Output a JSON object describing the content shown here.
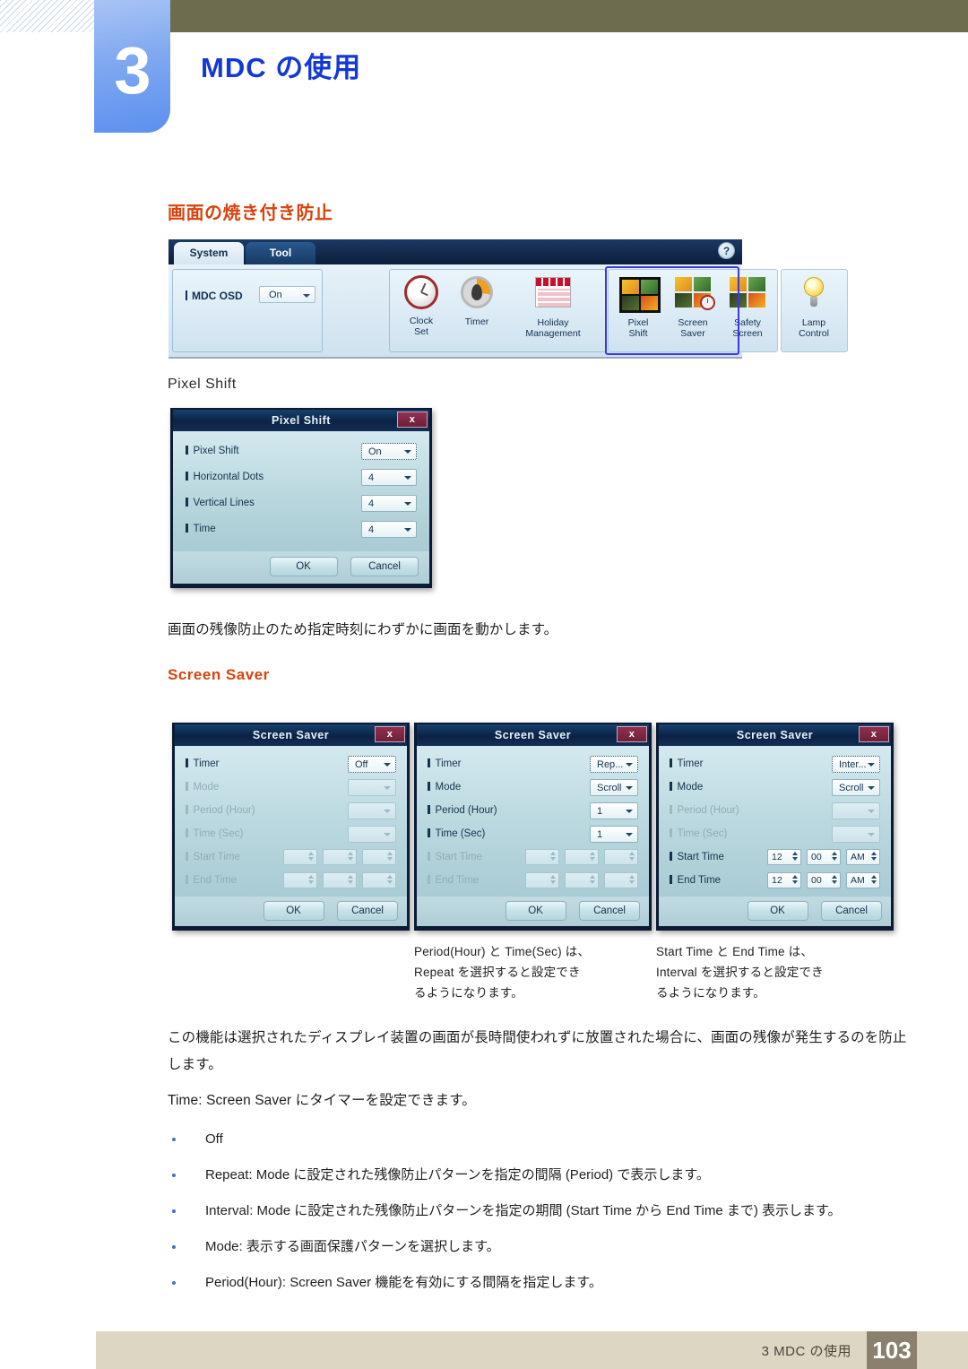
{
  "header": {
    "chapter_number": "3",
    "chapter_title": "MDC の使用"
  },
  "section": {
    "heading": "画面の焼き付き防止"
  },
  "toolbar": {
    "tabs": [
      {
        "label": "System",
        "active": true
      },
      {
        "label": "Tool",
        "active": false
      }
    ],
    "help_label": "?",
    "osd": {
      "label": "MDC OSD",
      "value": "On"
    },
    "items": [
      {
        "label_line1": "Clock",
        "label_line2": "Set",
        "icon": "clock-icon"
      },
      {
        "label_line1": "Timer",
        "label_line2": "",
        "icon": "timer-icon"
      },
      {
        "label_line1": "Holiday",
        "label_line2": "Management",
        "icon": "calendar-icon"
      },
      {
        "label_line1": "Pixel",
        "label_line2": "Shift",
        "icon": "pixel-shift-icon"
      },
      {
        "label_line1": "Screen",
        "label_line2": "Saver",
        "icon": "screen-saver-icon"
      },
      {
        "label_line1": "Safety",
        "label_line2": "Screen",
        "icon": "safety-screen-icon"
      },
      {
        "label_line1": "Lamp",
        "label_line2": "Control",
        "icon": "lamp-control-icon"
      }
    ]
  },
  "pixel_shift": {
    "subhead": "Pixel Shift",
    "dialog": {
      "title": "Pixel Shift",
      "close_label": "x",
      "rows": [
        {
          "label": "Pixel Shift",
          "value": "On",
          "disabled": false,
          "focus": true
        },
        {
          "label": "Horizontal Dots",
          "value": "4",
          "disabled": false,
          "focus": false
        },
        {
          "label": "Vertical Lines",
          "value": "4",
          "disabled": false,
          "focus": false
        },
        {
          "label": "Time",
          "value": "4",
          "disabled": false,
          "focus": false
        }
      ],
      "ok_label": "OK",
      "cancel_label": "Cancel"
    },
    "description": "画面の残像防止のため指定時刻にわずかに画面を動かします。"
  },
  "screen_saver": {
    "subhead": "Screen Saver",
    "dialogs": [
      {
        "title": "Screen Saver",
        "close_label": "x",
        "timer": {
          "label": "Timer",
          "value": "Off",
          "disabled": false,
          "focus": true
        },
        "mode": {
          "label": "Mode",
          "value": "",
          "disabled": true
        },
        "period": {
          "label": "Period (Hour)",
          "value": "",
          "disabled": true
        },
        "time": {
          "label": "Time (Sec)",
          "value": "",
          "disabled": true
        },
        "start_time": {
          "label": "Start Time",
          "hour": "",
          "minute": "",
          "meridiem": "",
          "disabled": true
        },
        "end_time": {
          "label": "End Time",
          "hour": "",
          "minute": "",
          "meridiem": "",
          "disabled": true
        },
        "ok_label": "OK",
        "cancel_label": "Cancel"
      },
      {
        "title": "Screen Saver",
        "close_label": "x",
        "timer": {
          "label": "Timer",
          "value": "Rep...",
          "disabled": false,
          "focus": true
        },
        "mode": {
          "label": "Mode",
          "value": "Scroll",
          "disabled": false
        },
        "period": {
          "label": "Period (Hour)",
          "value": "1",
          "disabled": false
        },
        "time": {
          "label": "Time (Sec)",
          "value": "1",
          "disabled": false
        },
        "start_time": {
          "label": "Start Time",
          "hour": "",
          "minute": "",
          "meridiem": "",
          "disabled": true
        },
        "end_time": {
          "label": "End Time",
          "hour": "",
          "minute": "",
          "meridiem": "",
          "disabled": true
        },
        "ok_label": "OK",
        "cancel_label": "Cancel"
      },
      {
        "title": "Screen Saver",
        "close_label": "x",
        "timer": {
          "label": "Timer",
          "value": "Inter...",
          "disabled": false,
          "focus": true
        },
        "mode": {
          "label": "Mode",
          "value": "Scroll",
          "disabled": false
        },
        "period": {
          "label": "Period (Hour)",
          "value": "",
          "disabled": true
        },
        "time": {
          "label": "Time (Sec)",
          "value": "",
          "disabled": true
        },
        "start_time": {
          "label": "Start Time",
          "hour": "12",
          "minute": "00",
          "meridiem": "AM",
          "disabled": false
        },
        "end_time": {
          "label": "End Time",
          "hour": "12",
          "minute": "00",
          "meridiem": "AM",
          "disabled": false
        },
        "ok_label": "OK",
        "cancel_label": "Cancel"
      }
    ],
    "captions": [
      "Period(Hour) と Time(Sec) は、\nRepeat を選択すると設定でき\nるようになります。",
      "Start Time と End Time は、\nInterval を選択すると設定でき\nるようになります。"
    ],
    "paragraph": "この機能は選択されたディスプレイ装置の画面が長時間使われずに放置された場合に、画面の残像が発生するのを防止します。",
    "time_note": "Time: Screen Saver にタイマーを設定できます。",
    "bullets": [
      "Off",
      "Repeat: Mode に設定された残像防止パターンを指定の間隔 (Period) で表示します。",
      "Interval: Mode に設定された残像防止パターンを指定の期間 (Start Time から End Time まで) 表示します。",
      "Mode: 表示する画面保護パターンを選択します。",
      "Period(Hour): Screen Saver 機能を有効にする間隔を指定します。"
    ]
  },
  "footer": {
    "text": "3 MDC の使用",
    "page": "103"
  },
  "colors": {
    "chapter_blue": "#1338d6",
    "heading_orange": "#d8420d",
    "olive": "#6e6c4f",
    "footer_beige": "#ddd6c3",
    "footer_page_box": "#8b7f6e",
    "selection_box": "#3f35e8"
  }
}
